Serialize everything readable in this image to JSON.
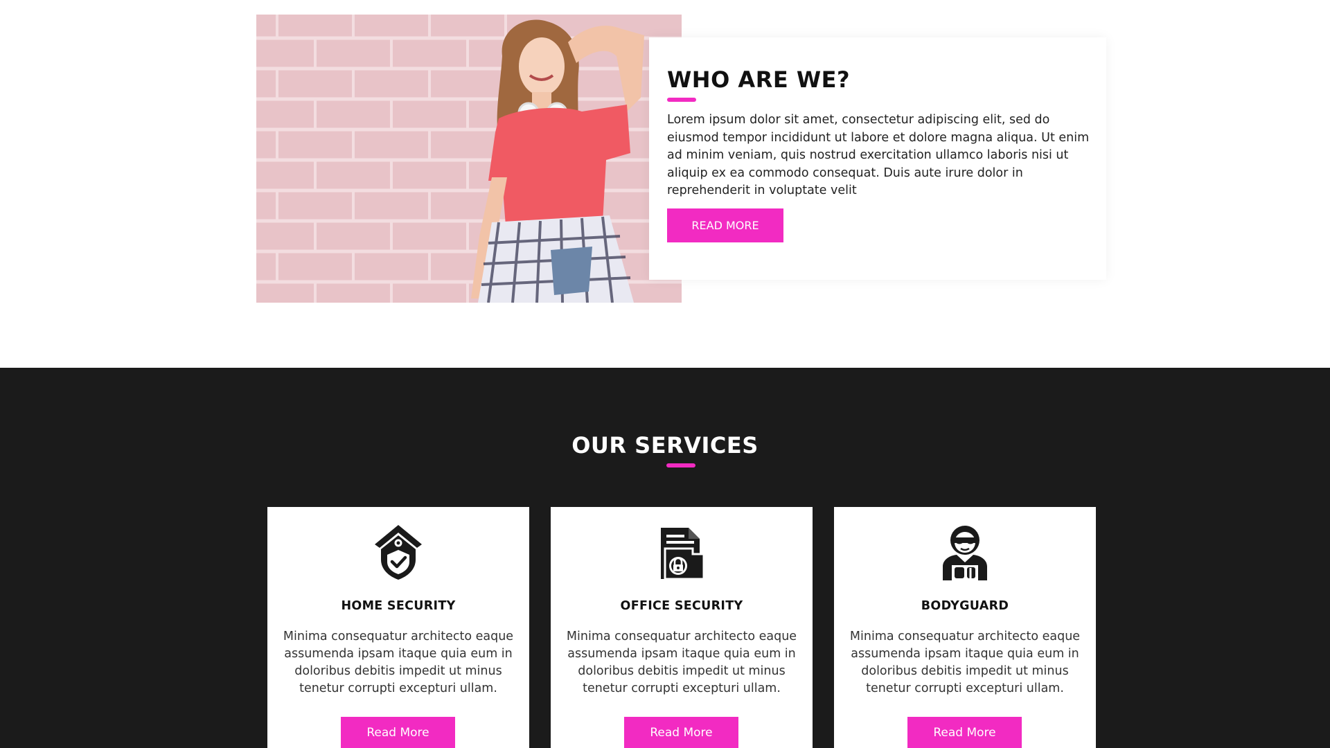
{
  "theme": {
    "accent": "#f22bc2",
    "dark_bg": "#1b1b1b",
    "light_bg": "#ffffff"
  },
  "about": {
    "image": "woman-with-headphones-photo",
    "title": "WHO ARE WE?",
    "text": "Lorem ipsum dolor sit amet, consectetur adipiscing elit, sed do eiusmod tempor incididunt ut labore et dolore magna aliqua. Ut enim ad minim veniam, quis nostrud exercitation ullamco laboris nisi ut aliquip ex ea commodo consequat. Duis aute irure dolor in reprehenderit in voluptate velit",
    "button_label": "READ MORE"
  },
  "services": {
    "title": "OUR SERVICES",
    "items": [
      {
        "icon": "home-security-icon",
        "title": "HOME SECURITY",
        "text": "Minima consequatur architecto eaque assumenda ipsam itaque quia eum in doloribus debitis impedit ut minus tenetur corrupti excepturi ullam.",
        "button_label": "Read More"
      },
      {
        "icon": "office-security-icon",
        "title": "OFFICE SECURITY",
        "text": "Minima consequatur architecto eaque assumenda ipsam itaque quia eum in doloribus debitis impedit ut minus tenetur corrupti excepturi ullam.",
        "button_label": "Read More"
      },
      {
        "icon": "bodyguard-icon",
        "title": "BODYGUARD",
        "text": "Minima consequatur architecto eaque assumenda ipsam itaque quia eum in doloribus debitis impedit ut minus tenetur corrupti excepturi ullam.",
        "button_label": "Read More"
      }
    ]
  }
}
